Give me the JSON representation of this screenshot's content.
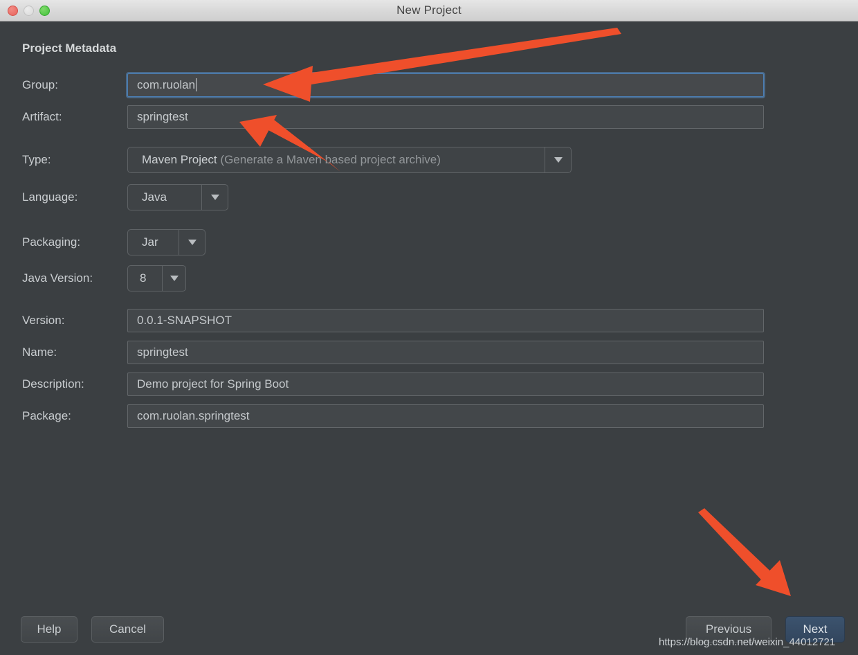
{
  "window": {
    "title": "New Project",
    "traffic_lights": [
      "close-light",
      "minimize-light",
      "maximize-light"
    ]
  },
  "form": {
    "section_title": "Project Metadata",
    "text_fields": [
      {
        "label": "Group:",
        "value": "com.ruolan",
        "focused": true
      },
      {
        "label": "Artifact:",
        "value": "springtest",
        "focused": false
      }
    ],
    "combos": [
      {
        "label": "Type:",
        "value": "Maven Project",
        "hint": "(Generate a Maven based project archive)"
      },
      {
        "label": "Language:",
        "value": "Java",
        "hint": ""
      },
      {
        "label": "Packaging:",
        "value": "Jar",
        "hint": ""
      },
      {
        "label": "Java Version:",
        "value": "8",
        "hint": ""
      }
    ],
    "lower_fields": [
      {
        "label": "Version:",
        "value": "0.0.1-SNAPSHOT"
      },
      {
        "label": "Name:",
        "value": "springtest"
      },
      {
        "label": "Description:",
        "value": "Demo project for Spring Boot"
      },
      {
        "label": "Package:",
        "value": "com.ruolan.springtest"
      }
    ]
  },
  "footer": {
    "help_label": "Help",
    "cancel_label": "Cancel",
    "previous_label": "Previous",
    "next_label": "Next"
  },
  "annotations": {
    "arrow_color": "#ef4f2b",
    "arrows": [
      {
        "name": "arrow-to-group-field",
        "direction": "left"
      },
      {
        "name": "arrow-to-artifact-field",
        "direction": "up-left"
      },
      {
        "name": "arrow-to-next-button",
        "direction": "down-right"
      }
    ]
  },
  "watermark": {
    "text": "https://blog.csdn.net/weixin_44012721"
  }
}
